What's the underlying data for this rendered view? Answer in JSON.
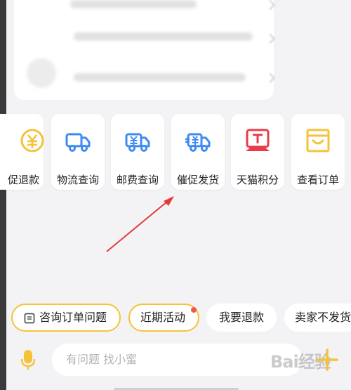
{
  "services": [
    {
      "label": "促退款",
      "icon": "refund-yen-icon"
    },
    {
      "label": "物流查询",
      "icon": "truck-icon"
    },
    {
      "label": "邮费查询",
      "icon": "postage-truck-icon"
    },
    {
      "label": "催促发货",
      "icon": "urge-shipping-truck-icon"
    },
    {
      "label": "天猫积分",
      "icon": "tmall-points-icon"
    },
    {
      "label": "查看订单",
      "icon": "order-box-icon"
    }
  ],
  "chips": [
    {
      "label": "咨询订单问题",
      "icon": "receipt-icon"
    },
    {
      "label": "近期活动"
    },
    {
      "label": "我要退款"
    },
    {
      "label": "卖家不发货"
    }
  ],
  "input": {
    "placeholder": "有问题 找小蜜"
  },
  "watermark": "Bai经验",
  "colors": {
    "accent_yellow": "#f5c337",
    "icon_blue": "#3d8bf2",
    "tmall_red": "#ea3b4a",
    "notify_dot": "#ef5a4f",
    "arrow": "#e53935"
  }
}
